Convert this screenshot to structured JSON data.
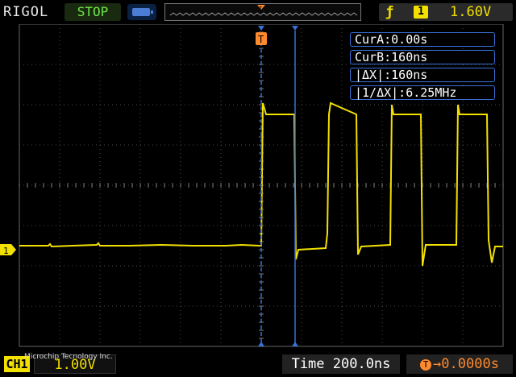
{
  "header": {
    "brand": "RIGOL",
    "run_state": "STOP",
    "trigger_edge_icon": "rising-edge-icon",
    "trigger_source": "1",
    "trigger_level": "1.60V"
  },
  "markers": {
    "trigger_marker": "T",
    "channel_marker": "1"
  },
  "cursors": {
    "cur_a": "CurA:0.00s",
    "cur_b": "CurB:160ns",
    "delta_x": "|ΔX|:160ns",
    "inv_delta_x": "|1/ΔX|:6.25MHz"
  },
  "footer": {
    "channel_badge": "CH1",
    "channel_scale": "1.00V",
    "watermark": "Microchip Tecnology Inc.",
    "timebase": "Time 200.0ns",
    "trigger_offset": "0.0000s",
    "trigger_offset_icon": "T"
  },
  "colors": {
    "channel1": "#f2e000",
    "cursor": "#3b6fd8",
    "trigger": "#ff8a2e",
    "run_state": "#6ee84a"
  }
}
